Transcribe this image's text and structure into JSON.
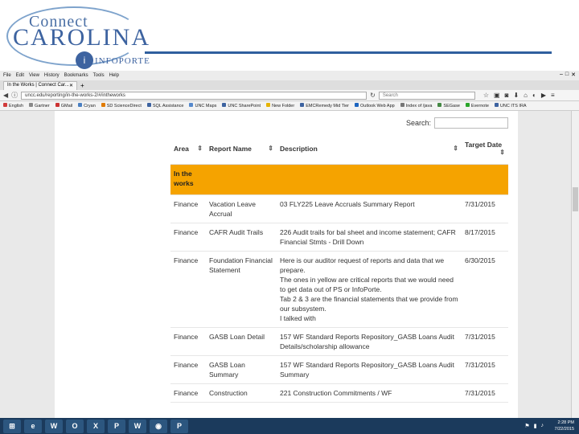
{
  "logo": {
    "connect": "Connect",
    "carolina": "CAROLINA",
    "infoporte": "INFOPORTE",
    "i_letter": "i"
  },
  "browser": {
    "menu": [
      "File",
      "Edit",
      "View",
      "History",
      "Bookmarks",
      "Tools",
      "Help"
    ],
    "tab_title": "In the Works | Connect Car...",
    "url": "uncc.edu/reporting/in-the-works-2/#/intheworks",
    "search_placeholder": "Search",
    "bookmarks": [
      {
        "label": "English",
        "color": "#d13c3c"
      },
      {
        "label": "Gartner",
        "color": "#888888"
      },
      {
        "label": "GMail",
        "color": "#cc3333"
      },
      {
        "label": "Cryan",
        "color": "#4a7fc1"
      },
      {
        "label": "SD ScienceDirect",
        "color": "#e07b00"
      },
      {
        "label": "SQL Assistance",
        "color": "#3d63a0"
      },
      {
        "label": "UNC Maps",
        "color": "#5588cc"
      },
      {
        "label": "UNC SharePoint",
        "color": "#3d63a0"
      },
      {
        "label": "New Folder",
        "color": "#e5b300"
      },
      {
        "label": "EMCRemedy Mid Tier",
        "color": "#3d63a0"
      },
      {
        "label": "Outlook Web App",
        "color": "#1e66c0"
      },
      {
        "label": "Index of /java",
        "color": "#777777"
      },
      {
        "label": "SEGase",
        "color": "#448844"
      },
      {
        "label": "Evernote",
        "color": "#2aa52a"
      },
      {
        "label": "UNC ITS IRA",
        "color": "#3d63a0"
      }
    ]
  },
  "search": {
    "label": "Search:"
  },
  "table": {
    "headers": {
      "area": "Area",
      "name": "Report Name",
      "desc": "Description",
      "date": "Target Date"
    },
    "group": "In the works",
    "rows": [
      {
        "area": "Finance",
        "name": "Vacation Leave Accrual",
        "desc": "03 FLY225 Leave Accruals Summary Report",
        "date": "7/31/2015"
      },
      {
        "area": "Finance",
        "name": "CAFR Audit Trails",
        "desc": "226 Audit trails for bal sheet and income statement; CAFR Financial Stmts - Drill Down",
        "date": "8/17/2015"
      },
      {
        "area": "Finance",
        "name": "Foundation Financial Statement",
        "desc": "Here is our auditor request of reports and data that we prepare.\nThe ones in yellow are critical reports that we would need to get data out of PS or InfoPorte.\nTab 2 & 3 are the financial statements that we provide from our subsystem.\nI talked with",
        "date": "6/30/2015"
      },
      {
        "area": "Finance",
        "name": "GASB Loan Detail",
        "desc": "157 WF Standard Reports Repository_GASB Loans Audit Details/scholarship allowance",
        "date": "7/31/2015"
      },
      {
        "area": "Finance",
        "name": "GASB Loan Summary",
        "desc": "157 WF Standard Reports Repository_GASB Loans Audit Summary",
        "date": "7/31/2015"
      },
      {
        "area": "Finance",
        "name": "Construction",
        "desc": "221 Construction Commitments / WF",
        "date": "7/31/2015"
      }
    ]
  },
  "taskbar": {
    "apps": [
      "⊞",
      "e",
      "W",
      "O",
      "X",
      "P",
      "W",
      "◉",
      "P"
    ],
    "time": "2:28 PM",
    "date": "7/22/2015"
  }
}
